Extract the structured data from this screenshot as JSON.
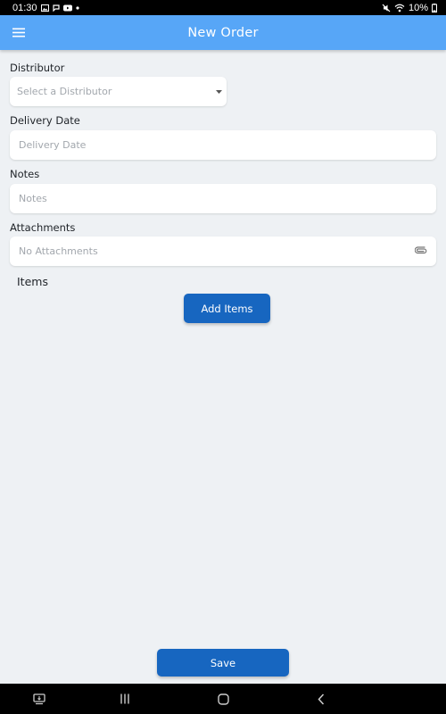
{
  "status_bar": {
    "time": "01:30",
    "left_icons": [
      "gallery-icon",
      "chat-icon",
      "youtube-icon",
      "dot-icon"
    ],
    "right_icons": [
      "mute-icon",
      "wifi-icon"
    ],
    "battery": "10%",
    "battery_icon": "battery-low-icon"
  },
  "app_bar": {
    "title": "New Order",
    "menu_icon": "hamburger-menu-icon",
    "color": "#57a6f7"
  },
  "form": {
    "distributor": {
      "label": "Distributor",
      "placeholder": "Select a Distributor"
    },
    "delivery_date": {
      "label": "Delivery Date",
      "placeholder": "Delivery Date"
    },
    "notes": {
      "label": "Notes",
      "placeholder": "Notes"
    },
    "attachments": {
      "label": "Attachments",
      "value": "No Attachments",
      "icon": "paperclip-icon"
    }
  },
  "items": {
    "heading": "Items",
    "add_button_label": "Add Items"
  },
  "save_button_label": "Save",
  "colors": {
    "primary_button": "#1766c0",
    "background": "#eef1f4"
  },
  "nav_bar": {
    "icons": [
      "screen-share-icon",
      "recent-apps-icon",
      "home-icon",
      "back-icon"
    ]
  }
}
